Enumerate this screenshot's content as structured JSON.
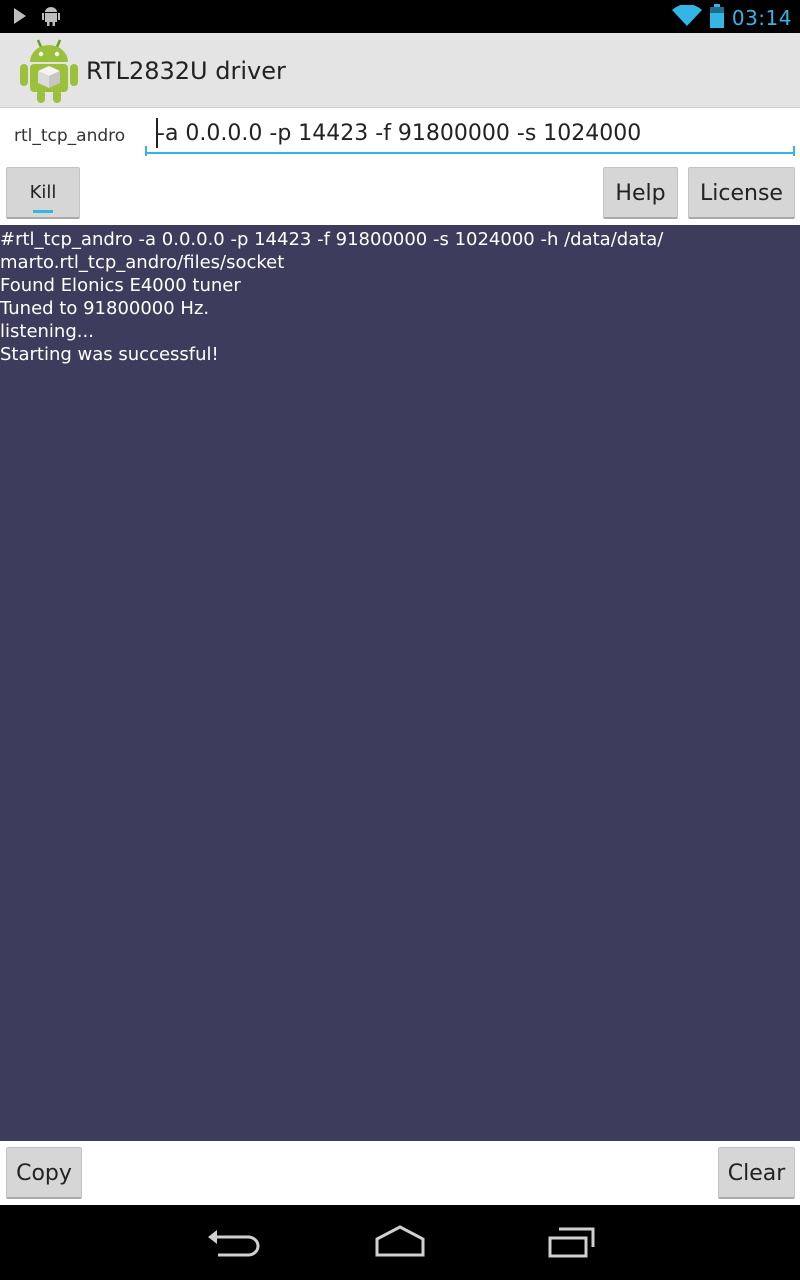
{
  "status_bar": {
    "time": "03:14",
    "icons": [
      "play-icon",
      "android-debug-icon",
      "wifi-icon",
      "battery-icon"
    ]
  },
  "app": {
    "title": "RTL2832U driver",
    "icon": "android-robot-icon"
  },
  "command": {
    "label": "rtl_tcp_andro",
    "value": "-a 0.0.0.0 -p 14423 -f 91800000 -s 1024000"
  },
  "buttons": {
    "kill": "Kill",
    "help": "Help",
    "license": "License",
    "copy": "Copy",
    "clear": "Clear"
  },
  "console": {
    "lines": [
      "#rtl_tcp_andro -a 0.0.0.0 -p 14423 -f 91800000 -s 1024000 -h /data/data/",
      "marto.rtl_tcp_andro/files/socket",
      "Found Elonics E4000 tuner",
      "Tuned to 91800000 Hz.",
      "listening...",
      "Starting was successful!"
    ]
  },
  "navigation": {
    "items": [
      "back-icon",
      "home-icon",
      "recent-apps-icon"
    ]
  },
  "colors": {
    "accent": "#33b5e5",
    "console_bg": "#3e3c5c",
    "action_bar": "#e4e4e4"
  }
}
